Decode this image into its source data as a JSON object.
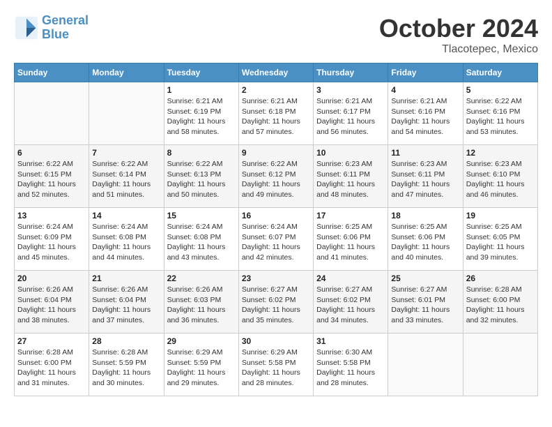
{
  "header": {
    "logo_line1": "General",
    "logo_line2": "Blue",
    "month": "October 2024",
    "location": "Tlacotepec, Mexico"
  },
  "days_of_week": [
    "Sunday",
    "Monday",
    "Tuesday",
    "Wednesday",
    "Thursday",
    "Friday",
    "Saturday"
  ],
  "weeks": [
    [
      {
        "day": "",
        "info": ""
      },
      {
        "day": "",
        "info": ""
      },
      {
        "day": "1",
        "info": "Sunrise: 6:21 AM\nSunset: 6:19 PM\nDaylight: 11 hours and 58 minutes."
      },
      {
        "day": "2",
        "info": "Sunrise: 6:21 AM\nSunset: 6:18 PM\nDaylight: 11 hours and 57 minutes."
      },
      {
        "day": "3",
        "info": "Sunrise: 6:21 AM\nSunset: 6:17 PM\nDaylight: 11 hours and 56 minutes."
      },
      {
        "day": "4",
        "info": "Sunrise: 6:21 AM\nSunset: 6:16 PM\nDaylight: 11 hours and 54 minutes."
      },
      {
        "day": "5",
        "info": "Sunrise: 6:22 AM\nSunset: 6:16 PM\nDaylight: 11 hours and 53 minutes."
      }
    ],
    [
      {
        "day": "6",
        "info": "Sunrise: 6:22 AM\nSunset: 6:15 PM\nDaylight: 11 hours and 52 minutes."
      },
      {
        "day": "7",
        "info": "Sunrise: 6:22 AM\nSunset: 6:14 PM\nDaylight: 11 hours and 51 minutes."
      },
      {
        "day": "8",
        "info": "Sunrise: 6:22 AM\nSunset: 6:13 PM\nDaylight: 11 hours and 50 minutes."
      },
      {
        "day": "9",
        "info": "Sunrise: 6:22 AM\nSunset: 6:12 PM\nDaylight: 11 hours and 49 minutes."
      },
      {
        "day": "10",
        "info": "Sunrise: 6:23 AM\nSunset: 6:11 PM\nDaylight: 11 hours and 48 minutes."
      },
      {
        "day": "11",
        "info": "Sunrise: 6:23 AM\nSunset: 6:11 PM\nDaylight: 11 hours and 47 minutes."
      },
      {
        "day": "12",
        "info": "Sunrise: 6:23 AM\nSunset: 6:10 PM\nDaylight: 11 hours and 46 minutes."
      }
    ],
    [
      {
        "day": "13",
        "info": "Sunrise: 6:24 AM\nSunset: 6:09 PM\nDaylight: 11 hours and 45 minutes."
      },
      {
        "day": "14",
        "info": "Sunrise: 6:24 AM\nSunset: 6:08 PM\nDaylight: 11 hours and 44 minutes."
      },
      {
        "day": "15",
        "info": "Sunrise: 6:24 AM\nSunset: 6:08 PM\nDaylight: 11 hours and 43 minutes."
      },
      {
        "day": "16",
        "info": "Sunrise: 6:24 AM\nSunset: 6:07 PM\nDaylight: 11 hours and 42 minutes."
      },
      {
        "day": "17",
        "info": "Sunrise: 6:25 AM\nSunset: 6:06 PM\nDaylight: 11 hours and 41 minutes."
      },
      {
        "day": "18",
        "info": "Sunrise: 6:25 AM\nSunset: 6:06 PM\nDaylight: 11 hours and 40 minutes."
      },
      {
        "day": "19",
        "info": "Sunrise: 6:25 AM\nSunset: 6:05 PM\nDaylight: 11 hours and 39 minutes."
      }
    ],
    [
      {
        "day": "20",
        "info": "Sunrise: 6:26 AM\nSunset: 6:04 PM\nDaylight: 11 hours and 38 minutes."
      },
      {
        "day": "21",
        "info": "Sunrise: 6:26 AM\nSunset: 6:04 PM\nDaylight: 11 hours and 37 minutes."
      },
      {
        "day": "22",
        "info": "Sunrise: 6:26 AM\nSunset: 6:03 PM\nDaylight: 11 hours and 36 minutes."
      },
      {
        "day": "23",
        "info": "Sunrise: 6:27 AM\nSunset: 6:02 PM\nDaylight: 11 hours and 35 minutes."
      },
      {
        "day": "24",
        "info": "Sunrise: 6:27 AM\nSunset: 6:02 PM\nDaylight: 11 hours and 34 minutes."
      },
      {
        "day": "25",
        "info": "Sunrise: 6:27 AM\nSunset: 6:01 PM\nDaylight: 11 hours and 33 minutes."
      },
      {
        "day": "26",
        "info": "Sunrise: 6:28 AM\nSunset: 6:00 PM\nDaylight: 11 hours and 32 minutes."
      }
    ],
    [
      {
        "day": "27",
        "info": "Sunrise: 6:28 AM\nSunset: 6:00 PM\nDaylight: 11 hours and 31 minutes."
      },
      {
        "day": "28",
        "info": "Sunrise: 6:28 AM\nSunset: 5:59 PM\nDaylight: 11 hours and 30 minutes."
      },
      {
        "day": "29",
        "info": "Sunrise: 6:29 AM\nSunset: 5:59 PM\nDaylight: 11 hours and 29 minutes."
      },
      {
        "day": "30",
        "info": "Sunrise: 6:29 AM\nSunset: 5:58 PM\nDaylight: 11 hours and 28 minutes."
      },
      {
        "day": "31",
        "info": "Sunrise: 6:30 AM\nSunset: 5:58 PM\nDaylight: 11 hours and 28 minutes."
      },
      {
        "day": "",
        "info": ""
      },
      {
        "day": "",
        "info": ""
      }
    ]
  ]
}
